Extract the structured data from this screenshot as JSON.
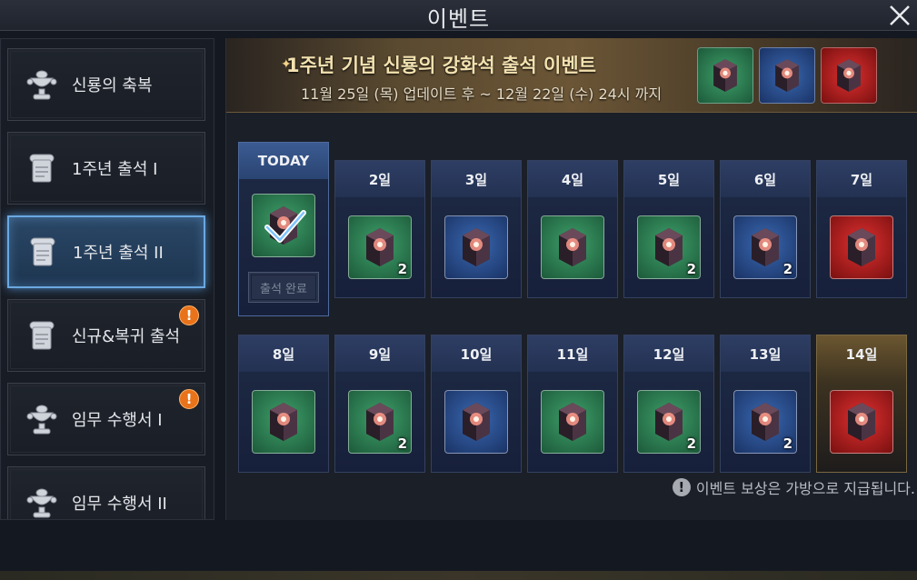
{
  "window": {
    "title": "이벤트"
  },
  "sidebar": {
    "items": [
      {
        "label": "신룡의 축복",
        "icon": "chalice-icon",
        "active": false,
        "alert": false
      },
      {
        "label": "1주년 출석 I",
        "icon": "scroll-icon",
        "active": false,
        "alert": false
      },
      {
        "label": "1주년 출석 II",
        "icon": "scroll-icon",
        "active": true,
        "alert": false
      },
      {
        "label": "신규&복귀 출석",
        "icon": "scroll-icon",
        "active": false,
        "alert": true
      },
      {
        "label": "임무 수행서 I",
        "icon": "chalice-icon",
        "active": false,
        "alert": true
      },
      {
        "label": "임무 수행서 II",
        "icon": "chalice-icon",
        "active": false,
        "alert": false
      }
    ],
    "alert_mark": "!"
  },
  "banner": {
    "title": "1주년 기념 신룡의 강화석 출석 이벤트",
    "subtitle": "11월 25일 (목) 업데이트 후 ~ 12월 22일 (수) 24시 까지",
    "preview_colors": [
      "green",
      "blue",
      "red"
    ]
  },
  "attendance": {
    "today_label": "TODAY",
    "done_label": "출석 완료",
    "days": [
      {
        "label": "TODAY",
        "color": "green",
        "qty": "",
        "checked": true
      },
      {
        "label": "2일",
        "color": "green",
        "qty": "2"
      },
      {
        "label": "3일",
        "color": "blue",
        "qty": ""
      },
      {
        "label": "4일",
        "color": "green",
        "qty": ""
      },
      {
        "label": "5일",
        "color": "green",
        "qty": "2"
      },
      {
        "label": "6일",
        "color": "blue",
        "qty": "2"
      },
      {
        "label": "7일",
        "color": "red",
        "qty": ""
      },
      {
        "label": "8일",
        "color": "green",
        "qty": ""
      },
      {
        "label": "9일",
        "color": "green",
        "qty": "2"
      },
      {
        "label": "10일",
        "color": "blue",
        "qty": ""
      },
      {
        "label": "11일",
        "color": "green",
        "qty": ""
      },
      {
        "label": "12일",
        "color": "green",
        "qty": "2"
      },
      {
        "label": "13일",
        "color": "blue",
        "qty": "2"
      },
      {
        "label": "14일",
        "color": "red",
        "qty": "",
        "highlight": true
      }
    ]
  },
  "footer": {
    "note": "이벤트 보상은 가방으로 지급됩니다.",
    "icon": "!"
  },
  "colors": {
    "accent": "#6aa8e0",
    "green": "#3fa06a",
    "blue": "#3a68b0",
    "red": "#e03030",
    "alert": "#e8731a"
  }
}
